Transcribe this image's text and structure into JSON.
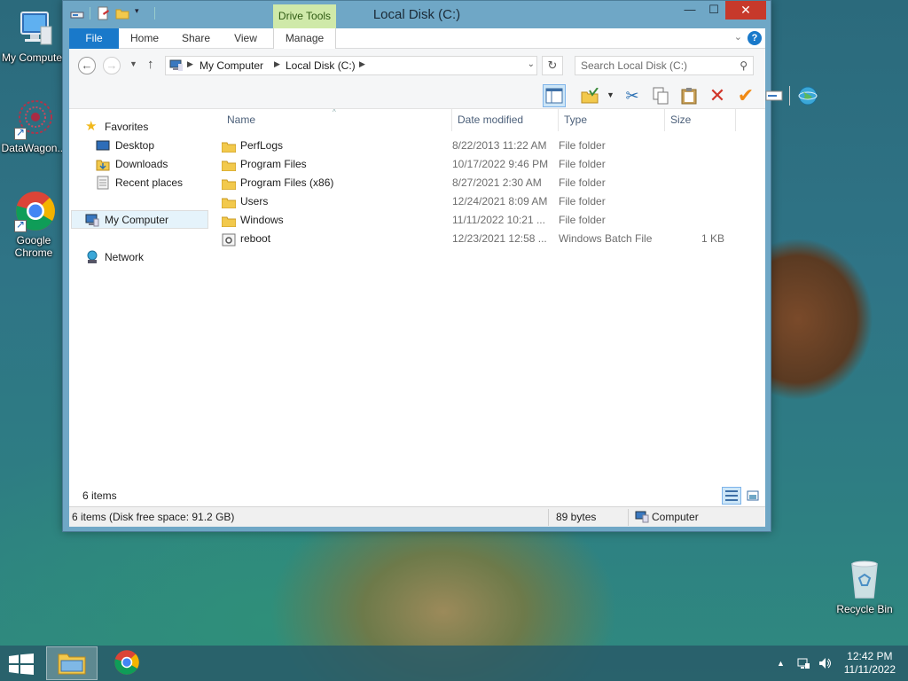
{
  "desktop": {
    "icons": [
      {
        "label": "My Computer"
      },
      {
        "label": "DataWagon..."
      },
      {
        "label": "Google Chrome"
      },
      {
        "label": "Recycle Bin"
      }
    ]
  },
  "window": {
    "title": "Local Disk (C:)",
    "contextual_tab": "Drive Tools",
    "controls": {
      "minimize": "—",
      "maximize": "☐",
      "close": "✕"
    }
  },
  "ribbon": {
    "tabs": [
      {
        "label": "File"
      },
      {
        "label": "Home"
      },
      {
        "label": "Share"
      },
      {
        "label": "View"
      },
      {
        "label": "Manage"
      }
    ],
    "help": "?"
  },
  "address": {
    "breadcrumbs": [
      "My Computer",
      "Local Disk (C:)"
    ],
    "search_placeholder": "Search Local Disk (C:)"
  },
  "navpane": {
    "favorites": "Favorites",
    "favorite_items": [
      "Desktop",
      "Downloads",
      "Recent places"
    ],
    "computer": "My Computer",
    "network": "Network"
  },
  "columns": {
    "name": "Name",
    "date": "Date modified",
    "type": "Type",
    "size": "Size"
  },
  "files": [
    {
      "name": "PerfLogs",
      "date": "8/22/2013 11:22 AM",
      "type": "File folder",
      "size": "",
      "icon": "folder-icon"
    },
    {
      "name": "Program Files",
      "date": "10/17/2022 9:46 PM",
      "type": "File folder",
      "size": "",
      "icon": "folder-icon"
    },
    {
      "name": "Program Files (x86)",
      "date": "8/27/2021 2:30 AM",
      "type": "File folder",
      "size": "",
      "icon": "folder-icon"
    },
    {
      "name": "Users",
      "date": "12/24/2021 8:09 AM",
      "type": "File folder",
      "size": "",
      "icon": "folder-icon"
    },
    {
      "name": "Windows",
      "date": "11/11/2022 10:21 ...",
      "type": "File folder",
      "size": "",
      "icon": "folder-icon"
    },
    {
      "name": "reboot",
      "date": "12/23/2021 12:58 ...",
      "type": "Windows Batch File",
      "size": "1 KB",
      "icon": "batch-file-icon"
    }
  ],
  "status": {
    "item_count": "6 items",
    "detail": "6 items (Disk free space: 91.2 GB)",
    "size": "89 bytes",
    "location": "Computer"
  },
  "taskbar": {
    "time": "12:42 PM",
    "date": "11/11/2022"
  },
  "colors": {
    "window_frame": "#6fa7c6",
    "file_tab": "#1979ca",
    "close_button": "#c7392b",
    "drive_tools": "#cfe9a9"
  }
}
